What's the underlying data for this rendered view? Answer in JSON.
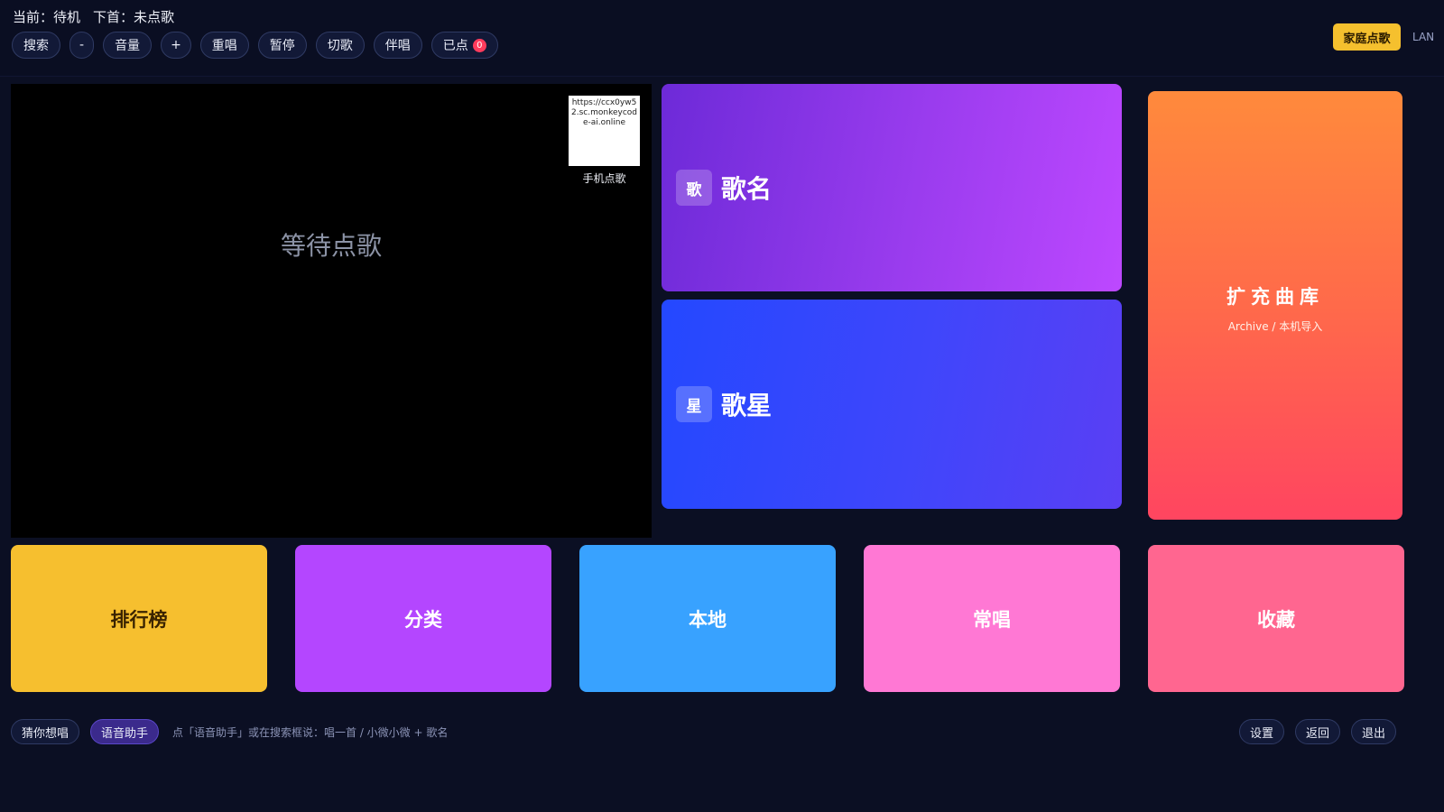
{
  "header": {
    "status_current": "当前：待机",
    "status_next": "下首：未点歌",
    "controls": {
      "search": "搜索",
      "vol_down": "-",
      "volume": "音量",
      "vol_up": "+",
      "replay": "重唱",
      "pause": "暂停",
      "skip": "切歌",
      "accompany": "伴唱",
      "queued": "已点",
      "queued_count": "0"
    },
    "family_button": "家庭点歌",
    "network": "LAN"
  },
  "player": {
    "waiting_text": "等待点歌",
    "qr_url": "https://ccx0yw52.sc.monkeycode-ai.online",
    "qr_label": "手机点歌"
  },
  "cards": {
    "song_name": {
      "icon_char": "歌",
      "title": "歌名"
    },
    "singer": {
      "icon_char": "星",
      "title": "歌星"
    },
    "expand": {
      "title": "扩充曲库",
      "subtitle": "Archive / 本机导入"
    }
  },
  "tiles": {
    "rank": "排行榜",
    "category": "分类",
    "local": "本地",
    "frequent": "常唱",
    "favorites": "收藏"
  },
  "footer": {
    "guess": "猜你想唱",
    "voice": "语音助手",
    "hint": "点「语音助手」或在搜索框说：唱一首 / 小微小微 + 歌名",
    "settings": "设置",
    "back": "返回",
    "exit": "退出"
  },
  "colors": {
    "background": "#0b0f23",
    "rank": "#f6bf2f",
    "category": "#b446ff",
    "local": "#38a2ff",
    "frequent": "#ff78d4",
    "favorites": "#ff6690",
    "family_button": "#f5c02e",
    "badge": "#ff3b5c"
  }
}
